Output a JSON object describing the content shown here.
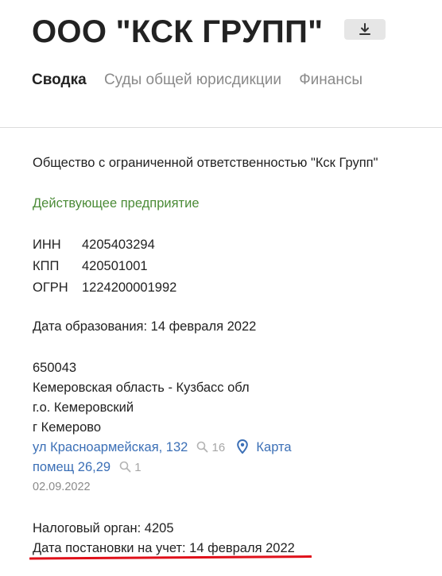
{
  "header": {
    "title": "ООО \"КСК ГРУПП\"",
    "download_icon": "download-icon"
  },
  "tabs": [
    {
      "label": "Сводка",
      "active": true
    },
    {
      "label": "Суды общей юрисдикции",
      "active": false
    },
    {
      "label": "Финансы",
      "active": false
    }
  ],
  "summary": {
    "full_name": "Общество с ограниченной ответственностью \"Кск Групп\"",
    "status": "Действующее предприятие",
    "status_color": "#4b8b37",
    "ids": [
      {
        "label": "ИНН",
        "value": "4205403294"
      },
      {
        "label": "КПП",
        "value": "420501001"
      },
      {
        "label": "ОГРН",
        "value": "1224200001992"
      }
    ],
    "founding_date": "Дата образования: 14 февраля 2022",
    "address": {
      "postal_code": "650043",
      "region": "Кемеровская область - Кузбасс обл",
      "district": "г.о. Кемеровский",
      "city": "г Кемерово",
      "street": "ул Красноармейская, 132",
      "street_search_count": "16",
      "map_link": "Карта",
      "room": "помещ 26,29",
      "room_search_count": "1",
      "date": "02.09.2022"
    },
    "tax_authority": "Налоговый орган: 4205",
    "registration_date": "Дата постановки на учет: 14 февраля 2022"
  },
  "colors": {
    "link": "#3b6fb6",
    "highlight_underline": "#e0101a"
  }
}
